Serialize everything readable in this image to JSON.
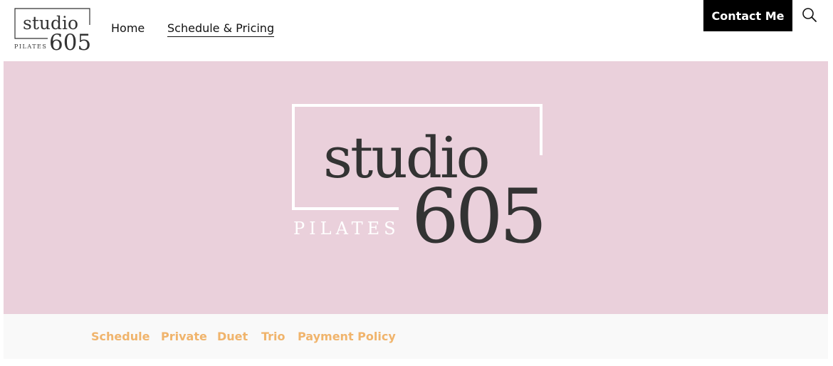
{
  "header": {
    "logo": {
      "wordmark_top": "studio",
      "wordmark_number": "605",
      "wordmark_sub": "PILATES"
    },
    "nav": [
      {
        "label": "Home",
        "active": false
      },
      {
        "label": "Schedule & Pricing",
        "active": true
      }
    ],
    "contact_label": "Contact Me",
    "search_icon": "search-icon"
  },
  "hero": {
    "background_color": "#ead0db",
    "logo": {
      "wordmark_top": "studio",
      "wordmark_number": "605",
      "wordmark_sub": "PILATES"
    }
  },
  "subnav": {
    "accent_color": "#f0b46c",
    "items": [
      {
        "label": "Schedule"
      },
      {
        "label": "Private"
      },
      {
        "label": "Duet"
      },
      {
        "label": "Trio"
      },
      {
        "label": "Payment Policy"
      }
    ]
  }
}
